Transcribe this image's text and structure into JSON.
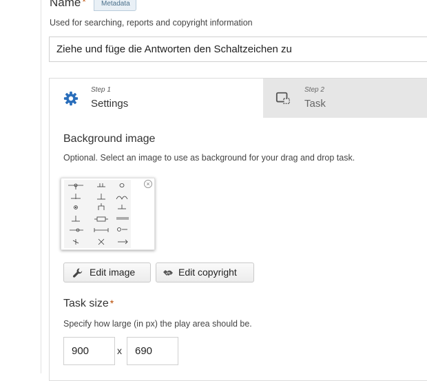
{
  "name_field": {
    "label": "Name",
    "required_mark": "*",
    "metadata_tag": "Metadata",
    "description": "Used for searching, reports and copyright information",
    "value": "Ziehe und füge die Antworten den Schaltzeichen zu"
  },
  "tabs": [
    {
      "step": "Step 1",
      "label": "Settings",
      "icon": "gear-icon",
      "active": true
    },
    {
      "step": "Step 2",
      "label": "Task",
      "icon": "task-icon",
      "active": false
    }
  ],
  "background_image": {
    "title": "Background image",
    "description": "Optional. Select an image to use as background for your drag and drop task.",
    "remove_symbol": "×",
    "edit_image_label": "Edit image",
    "edit_copyright_label": "Edit copyright"
  },
  "task_size": {
    "title": "Task size",
    "required_mark": "*",
    "description": "Specify how large (in px) the play area should be.",
    "width": "900",
    "separator": "x",
    "height": "690"
  },
  "colors": {
    "accent_blue": "#2a6ebb",
    "required_orange": "#b94a00",
    "inactive_tab": "#e6e6e6"
  }
}
